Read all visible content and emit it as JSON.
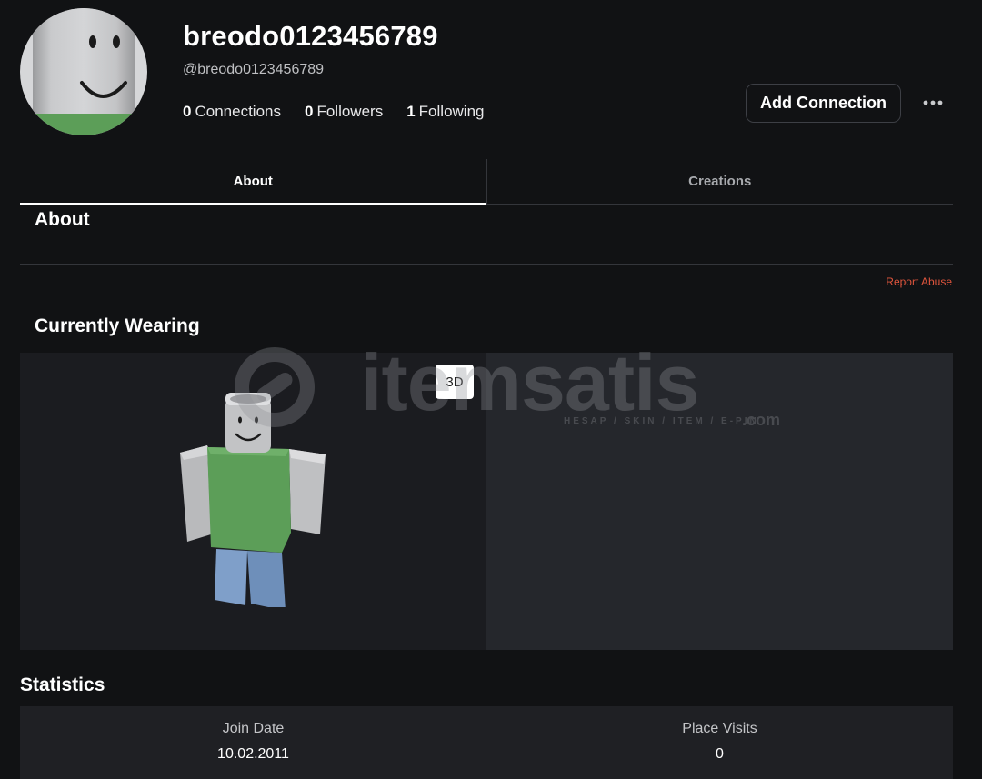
{
  "profile": {
    "display_name": "breodo0123456789",
    "username": "@breodo0123456789",
    "connections_count": "0",
    "connections_label": "Connections",
    "followers_count": "0",
    "followers_label": "Followers",
    "following_count": "1",
    "following_label": "Following",
    "add_connection_label": "Add Connection",
    "more_icon": "more-horizontal-icon"
  },
  "tabs": [
    {
      "label": "About",
      "active": true
    },
    {
      "label": "Creations",
      "active": false
    }
  ],
  "about": {
    "heading": "About",
    "report_abuse": "Report Abuse"
  },
  "wearing": {
    "heading": "Currently Wearing",
    "view_toggle": "3D"
  },
  "watermark": {
    "brand": "itemsatis",
    "tagline": "HESAP / SKIN / ITEM / E-PIN",
    "suffix": ".com"
  },
  "statistics": {
    "heading": "Statistics",
    "items": [
      {
        "label": "Join Date",
        "value": "10.02.2011"
      },
      {
        "label": "Place Visits",
        "value": "0"
      }
    ]
  },
  "colors": {
    "background": "#111214",
    "panel_dark": "#1b1c20",
    "panel_light": "#25272c",
    "report_link": "#e0553d",
    "shirt_green": "#5c9e58",
    "pants_blue": "#7f9fc9"
  }
}
